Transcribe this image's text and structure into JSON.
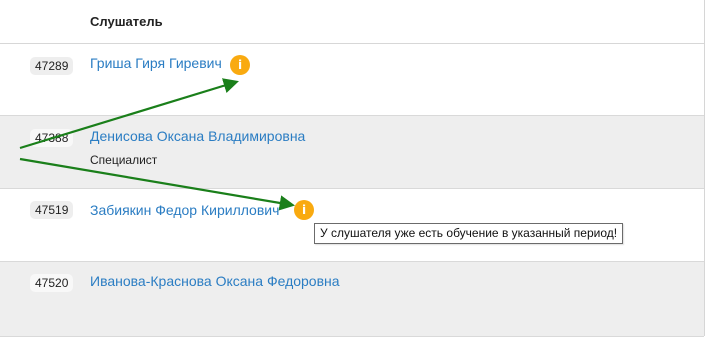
{
  "table": {
    "column_header": "Слушатель",
    "rows": [
      {
        "id": "47289",
        "name": "Гриша Гиря Гиревич",
        "role": "",
        "has_warning": true
      },
      {
        "id": "47388",
        "name": "Денисова Оксана Владимировна",
        "role": "Специалист",
        "has_warning": false
      },
      {
        "id": "47519",
        "name": "Забиякин Федор Кириллович",
        "role": "",
        "has_warning": true
      },
      {
        "id": "47520",
        "name": "Иванова-Краснова Оксана Федоровна",
        "role": "",
        "has_warning": false
      }
    ]
  },
  "icons": {
    "warning_symbol": "i",
    "warning_color": "#f9aa10",
    "link_color": "#2b7dc3",
    "arrow_color": "#1a7f1a"
  },
  "tooltip": {
    "text": "У слушателя уже есть обучение в указанный период!"
  }
}
